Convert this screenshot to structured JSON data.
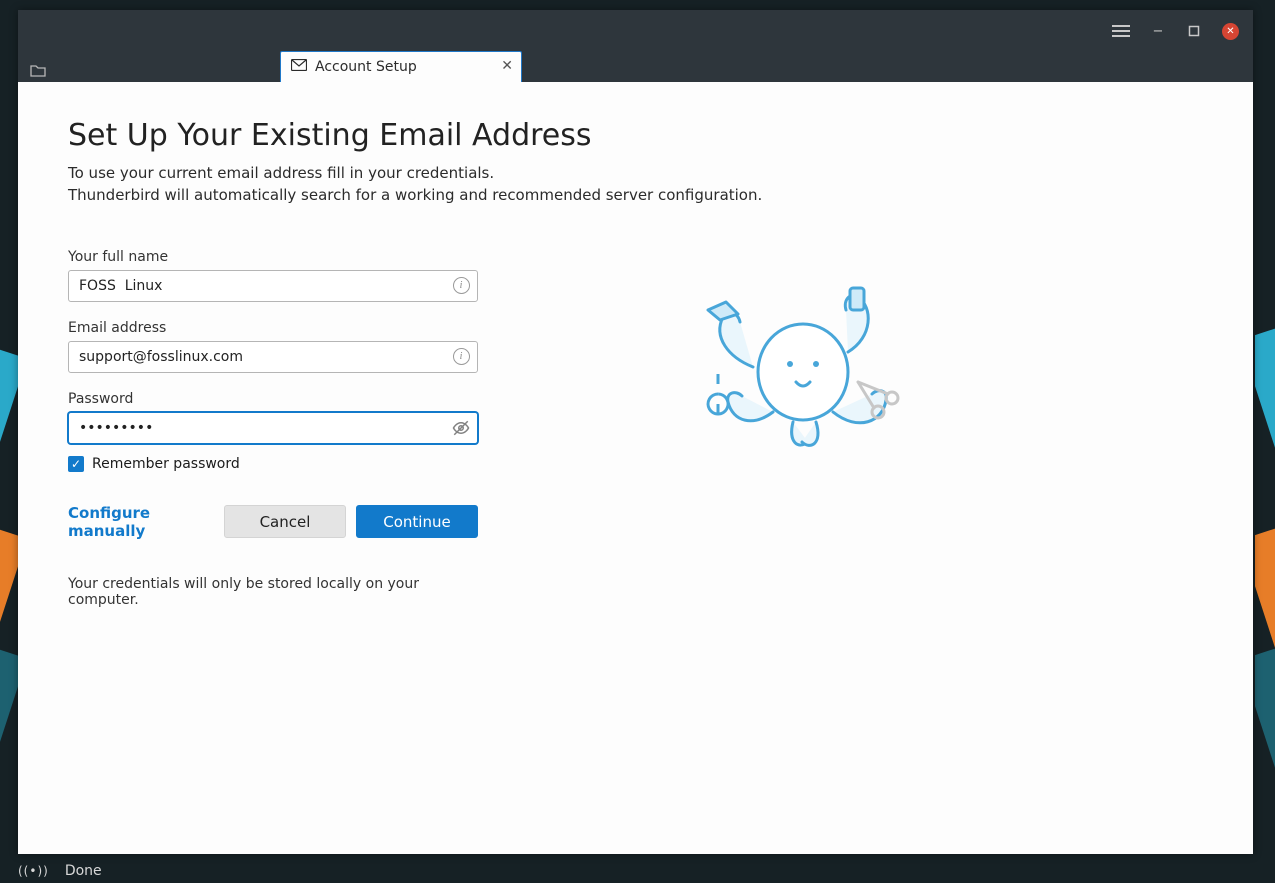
{
  "window": {
    "tab_label": "Account Setup"
  },
  "page": {
    "title": "Set Up Your Existing Email Address",
    "subtitle_line1": "To use your current email address fill in your credentials.",
    "subtitle_line2": "Thunderbird will automatically search for a working and recommended server configuration."
  },
  "form": {
    "full_name": {
      "label": "Your full name",
      "value": "FOSS  Linux"
    },
    "email": {
      "label": "Email address",
      "value": "support@fosslinux.com"
    },
    "password": {
      "label": "Password",
      "value": "•••••••••"
    },
    "remember_label": "Remember password",
    "remember_checked": true,
    "configure_manually": "Configure manually",
    "cancel": "Cancel",
    "continue": "Continue",
    "footnote": "Your credentials will only be stored locally on your computer."
  },
  "status": {
    "text": "Done"
  }
}
